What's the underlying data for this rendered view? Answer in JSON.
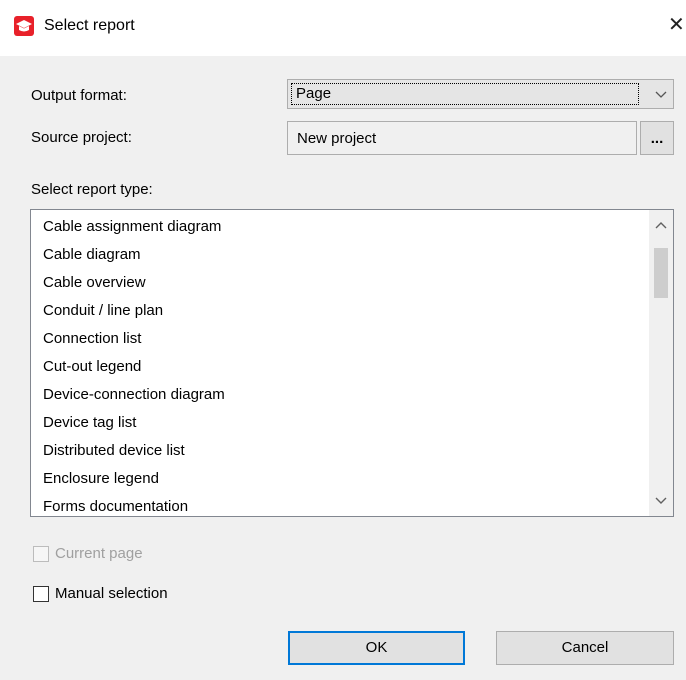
{
  "window": {
    "title": "Select report",
    "app_icon": "graduation-cap-icon",
    "accent": "#e8212a"
  },
  "output_format": {
    "label": "Output format:",
    "value": "Page"
  },
  "source_project": {
    "label": "Source project:",
    "value": "New project",
    "browse_label": "..."
  },
  "report_type": {
    "label": "Select report type:",
    "items": [
      "Cable assignment diagram",
      "Cable diagram",
      "Cable overview",
      "Conduit / line plan",
      "Connection list",
      "Cut-out legend",
      "Device-connection diagram",
      "Device tag list",
      "Distributed device list",
      "Enclosure legend",
      "Forms documentation"
    ]
  },
  "options": {
    "current_page": {
      "label": "Current page",
      "checked": false,
      "enabled": false
    },
    "manual_selection": {
      "label": "Manual selection",
      "checked": false,
      "enabled": true
    }
  },
  "buttons": {
    "ok": "OK",
    "cancel": "Cancel"
  },
  "colors": {
    "focus_border": "#0078d7",
    "disabled_text": "#a0a0a0"
  }
}
